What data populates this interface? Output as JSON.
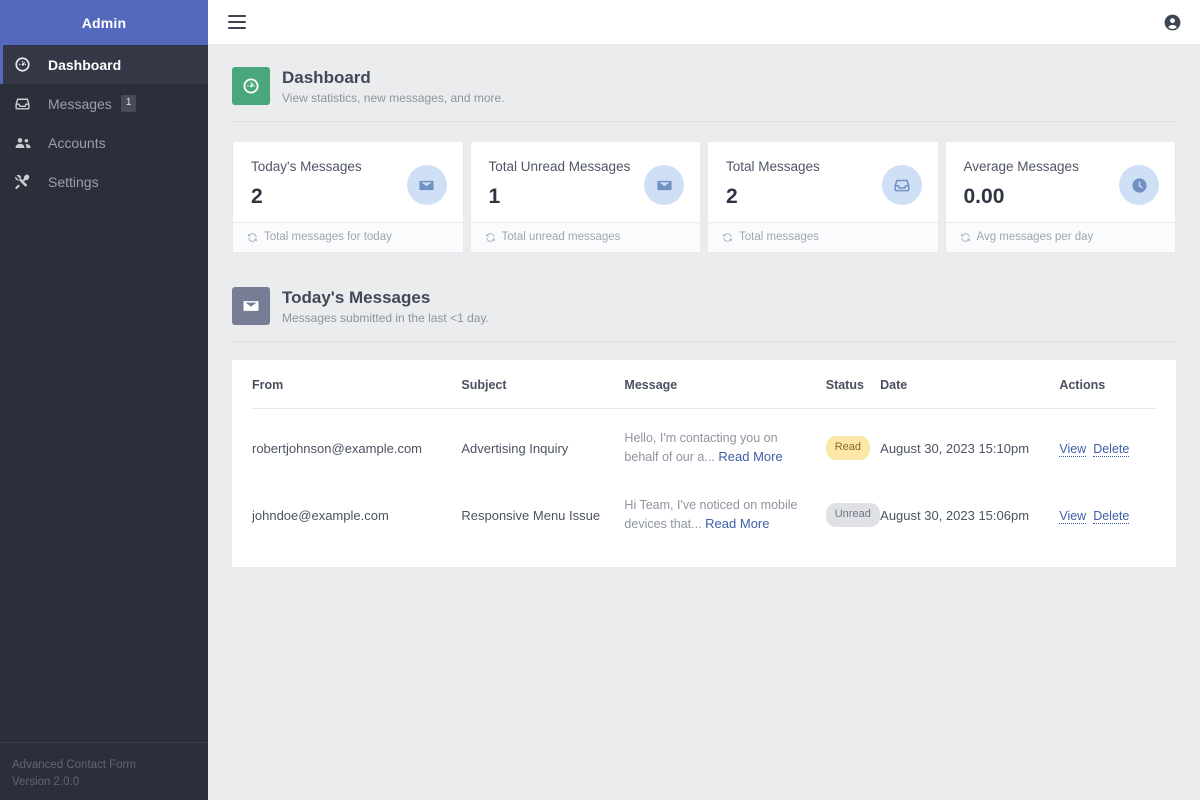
{
  "sidebar": {
    "brand": "Admin",
    "items": [
      {
        "label": "Dashboard",
        "icon": "gauge-icon",
        "badge": "",
        "active": true
      },
      {
        "label": "Messages",
        "icon": "inbox-icon",
        "badge": "1",
        "active": false
      },
      {
        "label": "Accounts",
        "icon": "users-icon",
        "badge": "",
        "active": false
      },
      {
        "label": "Settings",
        "icon": "tools-icon",
        "badge": "",
        "active": false
      }
    ],
    "footer": {
      "product": "Advanced Contact Form",
      "version": "Version 2.0.0"
    }
  },
  "topbar": {
    "menu_icon": "hamburger-icon",
    "account_icon": "user-circle-icon"
  },
  "page": {
    "title": "Dashboard",
    "subtitle": "View statistics, new messages, and more.",
    "icon": "gauge-icon",
    "icon_color": "#4aa67d"
  },
  "stats": [
    {
      "label": "Today's Messages",
      "value": "2",
      "icon": "envelope-icon",
      "footer": "Total messages for today"
    },
    {
      "label": "Total Unread Messages",
      "value": "1",
      "icon": "envelope-icon",
      "footer": "Total unread messages"
    },
    {
      "label": "Total Messages",
      "value": "2",
      "icon": "inbox-icon",
      "footer": "Total messages"
    },
    {
      "label": "Average Messages",
      "value": "0.00",
      "icon": "clock-icon",
      "footer": "Avg messages per day"
    }
  ],
  "messages_section": {
    "title": "Today's Messages",
    "subtitle": "Messages submitted in the last <1 day.",
    "icon": "envelope-icon",
    "icon_color": "#767d95"
  },
  "table": {
    "columns": [
      "From",
      "Subject",
      "Message",
      "Status",
      "Date",
      "Actions"
    ],
    "read_more_label": "Read More",
    "view_label": "View",
    "delete_label": "Delete",
    "rows": [
      {
        "from": "robertjohnson@example.com",
        "subject": "Advertising Inquiry",
        "message": "Hello, I'm contacting you on behalf of our a...",
        "status": "Read",
        "status_kind": "read",
        "date": "August 30, 2023 15:10pm"
      },
      {
        "from": "johndoe@example.com",
        "subject": "Responsive Menu Issue",
        "message": "Hi Team, I've noticed on mobile devices that...",
        "status": "Unread",
        "status_kind": "unread",
        "date": "August 30, 2023 15:06pm"
      }
    ]
  },
  "colors": {
    "brand": "#5468bd",
    "sidebar": "#2b2f3a",
    "sidebar_active": "#343846",
    "accent_green": "#4aa67d",
    "accent_gray": "#767d95",
    "stat_icon_bg": "#cfdff6",
    "stat_icon_fg": "#7190c4",
    "badge_read_bg": "#fbe7a8",
    "badge_unread_bg": "#dfe1e5",
    "link": "#3d5fa8",
    "content_bg": "#ebecee"
  }
}
